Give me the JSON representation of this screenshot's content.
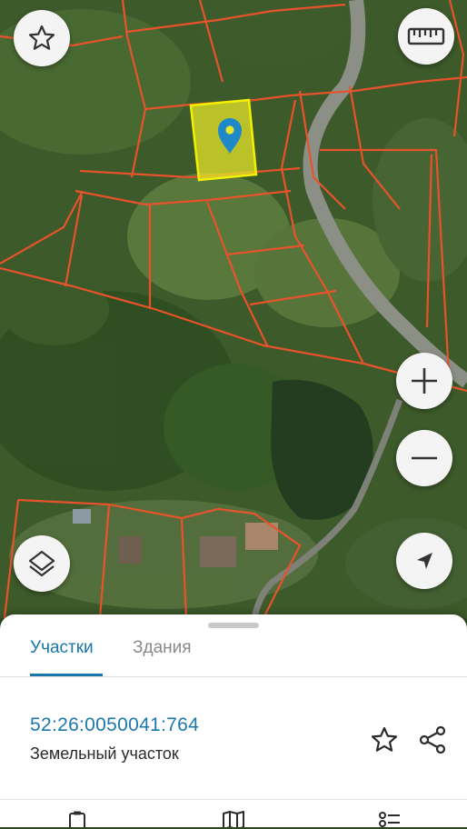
{
  "map": {
    "type": "satellite",
    "parcel_outline_color": "#e8532c",
    "selected_parcel_fill": "#e6e62a",
    "selected_parcel_stroke": "#f3f000",
    "marker_color": "#1e88c8"
  },
  "controls": {
    "favorite_icon": "star-icon",
    "ruler_icon": "ruler-icon",
    "zoom_in_icon": "plus-icon",
    "zoom_out_icon": "minus-icon",
    "layers_icon": "layers-icon",
    "locate_icon": "location-arrow-icon"
  },
  "sheet": {
    "tabs": [
      {
        "label": "Участки",
        "active": true
      },
      {
        "label": "Здания",
        "active": false
      }
    ],
    "parcel": {
      "cadastral_number": "52:26:0050041:764",
      "type": "Земельный участок"
    },
    "accent_color": "#1877a8"
  },
  "bottom_nav": {
    "icons": [
      "clipboard-icon",
      "map-icon",
      "list-icon"
    ]
  }
}
